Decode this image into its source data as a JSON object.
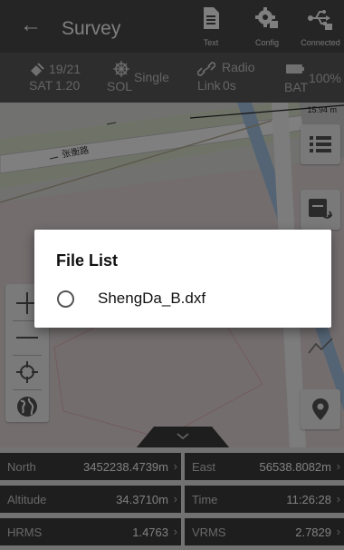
{
  "header": {
    "back_label": "←",
    "title": "Survey",
    "buttons": [
      {
        "label": "Text",
        "icon": "document-icon"
      },
      {
        "label": "Config",
        "icon": "gear-config-icon"
      },
      {
        "label": "Connected",
        "icon": "usb-connected-icon"
      }
    ]
  },
  "status": {
    "sats": "19/21",
    "sat_label": "SAT",
    "sat_value": "1.20",
    "sol_label": "SOL",
    "sol_value": "Single",
    "link_top": "Radio",
    "link_label": "Link",
    "link_value": "0s",
    "bat_label": "BAT",
    "bat_value": "100%"
  },
  "map": {
    "scale_label": "15.94 m",
    "road_label": "张衡路"
  },
  "dialog": {
    "title": "File List",
    "files": [
      "ShengDa_B.dxf"
    ]
  },
  "data_grid": [
    {
      "key": "North",
      "value": "3452238.4739m"
    },
    {
      "key": "East",
      "value": "56538.8082m"
    },
    {
      "key": "Altitude",
      "value": "34.3710m"
    },
    {
      "key": "Time",
      "value": "11:26:28"
    },
    {
      "key": "HRMS",
      "value": "1.4763"
    },
    {
      "key": "VRMS",
      "value": "2.7829"
    }
  ],
  "colors": {
    "header_bg": "#4a4a4a",
    "status_bg": "#5a5a5a",
    "grid_cell_bg": "#3c3c3c",
    "map_bg": "#e3e3df",
    "dialog_bg": "#ffffff"
  }
}
